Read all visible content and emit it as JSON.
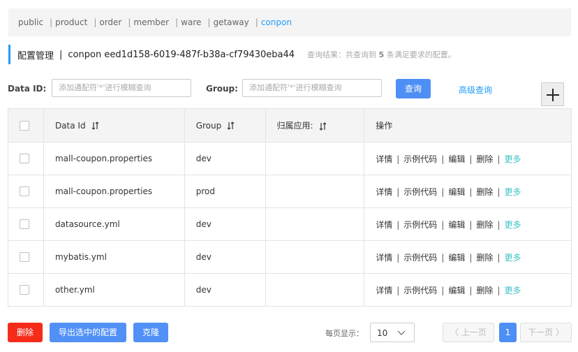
{
  "namespaces": [
    {
      "label": "public",
      "active": false
    },
    {
      "label": "product",
      "active": false
    },
    {
      "label": "order",
      "active": false
    },
    {
      "label": "member",
      "active": false
    },
    {
      "label": "ware",
      "active": false
    },
    {
      "label": "getaway",
      "active": false
    },
    {
      "label": "conpon",
      "active": true
    }
  ],
  "title": {
    "main": "配置管理",
    "separator": "|",
    "namespace": "conpon  eed1d158-6019-487f-b38a-cf79430eba44",
    "result_prefix": "查询结果：共查询到 ",
    "result_count": "5",
    "result_suffix": " 条满足要求的配置。"
  },
  "search": {
    "dataid_label": "Data ID:",
    "dataid_placeholder": "添加通配符'*'进行模糊查询",
    "group_label": "Group:",
    "group_placeholder": "添加通配符'*'进行模糊查询",
    "query_button": "查询",
    "advanced_link": "高级查询"
  },
  "table": {
    "headers": {
      "dataid": "Data Id",
      "group": "Group",
      "app": "归属应用:",
      "ops": "操作"
    },
    "rows": [
      {
        "dataid": "mall-coupon.properties",
        "group": "dev",
        "app": ""
      },
      {
        "dataid": "mall-coupon.properties",
        "group": "prod",
        "app": ""
      },
      {
        "dataid": "datasource.yml",
        "group": "dev",
        "app": ""
      },
      {
        "dataid": "mybatis.yml",
        "group": "dev",
        "app": ""
      },
      {
        "dataid": "other.yml",
        "group": "dev",
        "app": ""
      }
    ],
    "ops": {
      "detail": "详情",
      "sample": "示例代码",
      "edit": "编辑",
      "delete": "删除",
      "more": "更多",
      "sep": "|"
    }
  },
  "footer": {
    "delete_button": "删除",
    "export_button": "导出选中的配置",
    "clone_button": "克隆",
    "page_size_label": "每页显示：",
    "page_size": "10",
    "prev": "上一页",
    "page": "1",
    "next": "下一页"
  },
  "colors": {
    "accent": "#209bfa",
    "primary_button": "#4e8ff5",
    "danger": "#f52c1a",
    "more_link": "#3ec2c8"
  }
}
